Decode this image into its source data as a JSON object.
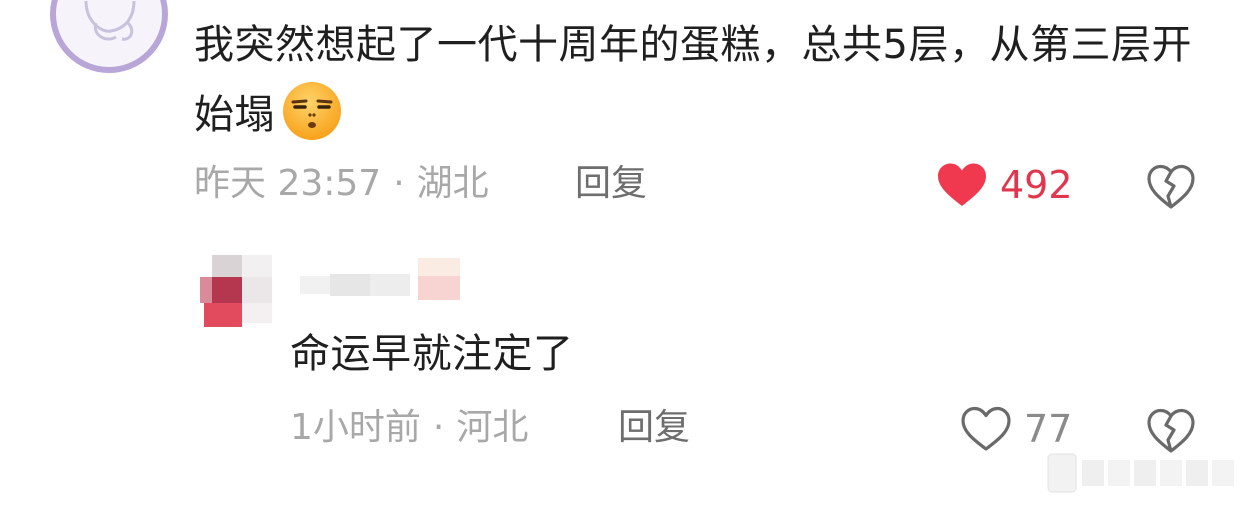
{
  "comment": {
    "text": "我突然想起了一代十周年的蛋糕，总共5层，从第三层开始塌",
    "emoji": "unamused-face-emoji",
    "time": "昨天 23:57",
    "location": "湖北",
    "reply_label": "回复",
    "likes": "492",
    "liked": true,
    "like_color": "#f0394f"
  },
  "reply": {
    "text": "命运早就注定了",
    "time": "1小时前",
    "location": "河北",
    "reply_label": "回复",
    "likes": "77",
    "liked": false
  },
  "colors": {
    "meta_text": "#a8a8a8",
    "like_count_active": "#e0374e",
    "like_count_idle": "#8a8a8a",
    "avatar_ring": "#b9a6d8"
  }
}
